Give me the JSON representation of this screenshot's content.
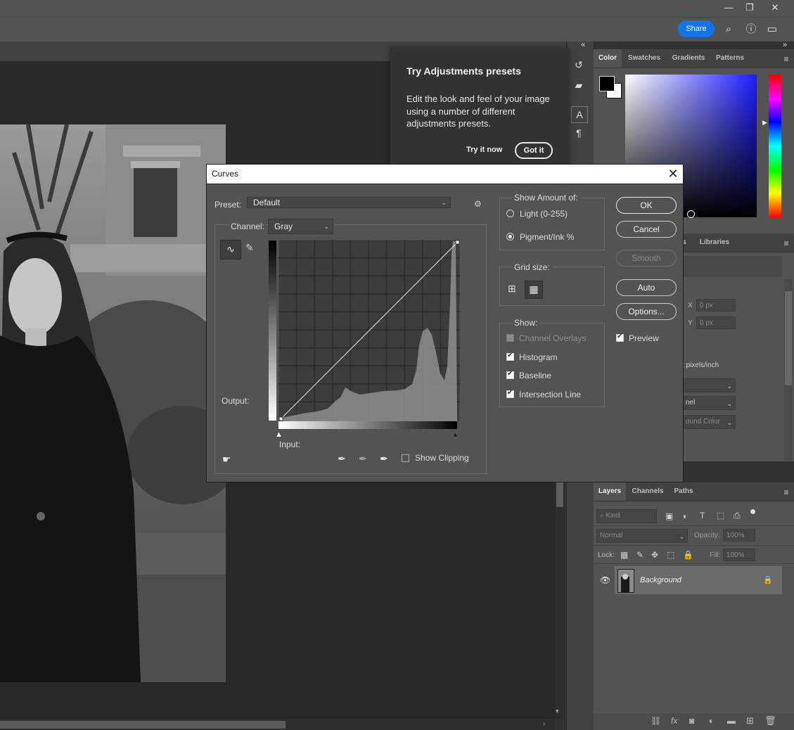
{
  "colors": {
    "accent": "#1473e6",
    "panel": "#535353",
    "canvas": "#282828"
  },
  "topbar": {
    "share_label": "Share",
    "window_controls": [
      "minimize-icon",
      "restore-icon",
      "close-icon"
    ],
    "icons": [
      "search-icon",
      "help-icon",
      "workspace-icon"
    ]
  },
  "toolstrip": {
    "icons": [
      "history-icon",
      "comment-icon",
      "character-icon",
      "paragraph-icon"
    ]
  },
  "adjustments_popup": {
    "title": "Try Adjustments presets",
    "body": "Edit the look and feel of your image using a number of different adjustments presets.",
    "try_label": "Try it now",
    "got_label": "Got it"
  },
  "color_panel": {
    "tabs": [
      "Color",
      "Swatches",
      "Gradients",
      "Patterns"
    ],
    "active_tab": "Color"
  },
  "props_panel": {
    "tabs": [
      "s",
      "Libraries"
    ],
    "x_label": "X",
    "y_label": "Y",
    "x_value": "0 px",
    "y_value": "0 px",
    "resolution": "t pixels/inch",
    "select2": "nel",
    "select3": "ound Color"
  },
  "curves": {
    "title": "Curves",
    "preset_label": "Preset:",
    "preset_value": "Default",
    "channel_label": "Channel:",
    "channel_value": "Gray",
    "output_label": "Output:",
    "input_label": "Input:",
    "show_clipping": "Show Clipping",
    "show_amount_title": "Show Amount of:",
    "light_label": "Light  (0-255)",
    "pigment_label": "Pigment/Ink %",
    "grid_size_title": "Grid size:",
    "show_title": "Show:",
    "channel_overlays": "Channel Overlays",
    "histogram": "Histogram",
    "baseline": "Baseline",
    "intersection_line": "Intersection Line",
    "buttons": {
      "ok": "OK",
      "cancel": "Cancel",
      "smooth": "Smooth",
      "auto": "Auto",
      "options": "Options..."
    },
    "preview": "Preview"
  },
  "layers_panel": {
    "tabs": [
      "Layers",
      "Channels",
      "Paths"
    ],
    "active_tab": "Layers",
    "kind_placeholder": "Kind",
    "blend_mode": "Normal",
    "opacity_label": "Opacity:",
    "opacity_value": "100%",
    "lock_label": "Lock:",
    "fill_label": "Fill:",
    "fill_value": "100%",
    "layers": [
      {
        "name": "Background",
        "locked": true,
        "visible": true
      }
    ]
  }
}
